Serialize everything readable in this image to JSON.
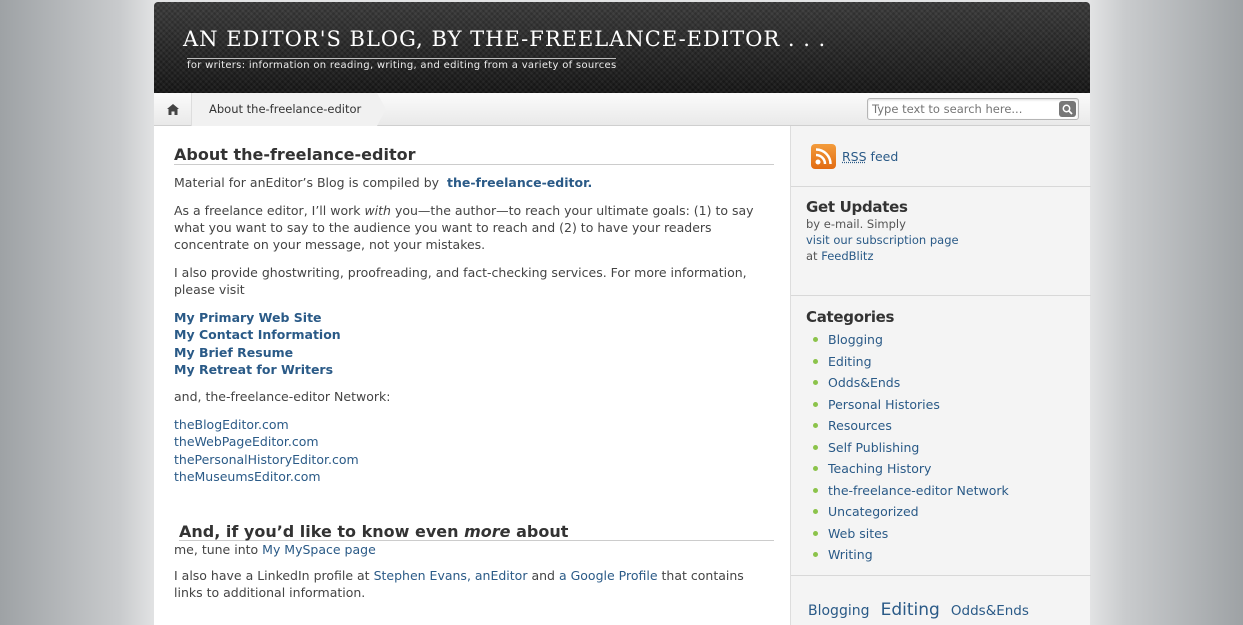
{
  "header": {
    "title": "AN EDITOR'S BLOG, BY THE-FREELANCE-EDITOR . . .",
    "description": "for writers: information on reading, writing, and editing from a variety of sources"
  },
  "nav": {
    "home_icon": "home-icon",
    "breadcrumb": "About the-freelance-editor",
    "search_placeholder": "Type text to search here..."
  },
  "main": {
    "heading": "About the-freelance-editor",
    "intro_text": "Material for anEditor’s Blog is compiled by",
    "intro_link": "the-freelance-editor.",
    "para2_a": "As a freelance editor, I’ll work",
    "para2_em": "with",
    "para2_b": "you—the author—to reach your ultimate goals:  (1) to say what you want to say to the audience you want to reach and  (2) to have your readers concentrate on your message, not your mistakes.",
    "para3": "I also provide ghostwriting, proofreading, and fact-checking services. For more information, please visit",
    "links": [
      "My Primary Web Site",
      "My Contact Information",
      "My Brief Resume",
      "My Retreat for Writers"
    ],
    "network_intro": "and, the-freelance-editor Network:",
    "network": [
      "theBlogEditor.com",
      "theWebPageEditor.com",
      "thePersonalHistoryEditor.com",
      "theMuseumsEditor.com"
    ],
    "heading2_a": "And, if you’d like to know even",
    "heading2_em": "more",
    "heading2_b": "about",
    "myspace_text": "me, tune into",
    "myspace_link": "My MySpace page",
    "linkedin_a": "I also have a LinkedIn profile at",
    "linkedin_link": "Stephen Evans, anEditor",
    "linkedin_b": "and",
    "google_link": "a Google Profile",
    "linkedin_c": "that contains links to additional information."
  },
  "sidebar": {
    "rss_icon": "rss-icon",
    "rss_abbr": "RSS",
    "rss_label": "feed",
    "updates_title": "Get Updates",
    "updates_line1": "by e-mail. Simply",
    "updates_link": "visit our subscription page",
    "updates_at": "at",
    "updates_feedblitz": "FeedBlitz",
    "categories_title": "Categories",
    "categories": [
      "Blogging",
      "Editing",
      "Odds&Ends",
      "Personal Histories",
      "Resources",
      "Self Publishing",
      "Teaching History",
      "the-freelance-editor Network",
      "Uncategorized",
      "Web sites",
      "Writing"
    ],
    "tags": [
      "Blogging",
      "Editing",
      "Odds&Ends"
    ]
  },
  "colors": {
    "link": "#2a5a87",
    "header_bg": "#1e1e1e",
    "bullet": "#8bc34a",
    "rss": "#e8791c"
  }
}
